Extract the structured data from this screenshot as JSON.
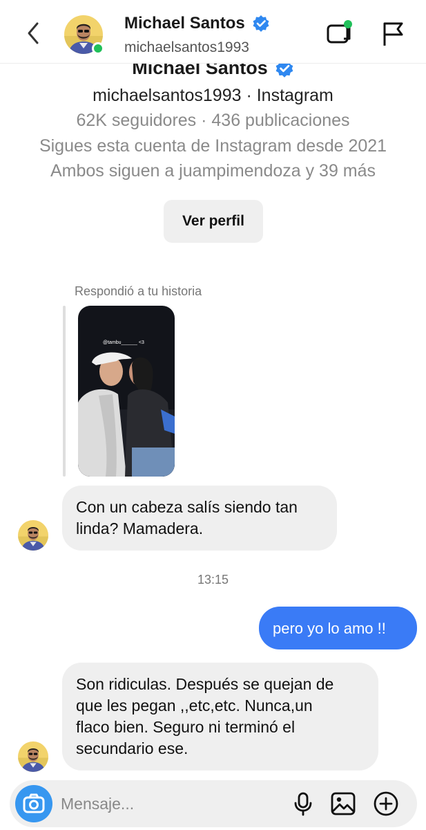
{
  "header": {
    "name": "Michael Santos",
    "username": "michaelsantos1993",
    "icons": [
      "back-chevron-icon",
      "verified-badge-icon",
      "video-call-icon",
      "report-flag-icon"
    ]
  },
  "profile": {
    "name": "Michael Santos",
    "subtitle": "michaelsantos1993 · Instagram",
    "stats": "62K seguidores · 436 publicaciones",
    "following_since": "Sigues esta cuenta de Instagram desde 2021",
    "mutuals": "Ambos siguen a juampimendoza y 39 más",
    "view_profile_label": "Ver perfil"
  },
  "story_reply": {
    "caption": "Respondió a tu historia",
    "thumb_tag": "@tambu______ <3"
  },
  "messages": [
    {
      "direction": "incoming",
      "lines": [
        "Con un cabeza salís siendo tan",
        "linda? Mamadera."
      ]
    },
    {
      "direction": "separator",
      "text": "13:15"
    },
    {
      "direction": "outgoing",
      "text": "pero yo lo amo !!"
    },
    {
      "direction": "incoming",
      "lines": [
        "Son ridiculas. Después se quejan de",
        "que les pegan ,,etc,etc. Nunca,un",
        "flaco bien. Seguro ni terminó el",
        "secundario ese."
      ]
    }
  ],
  "composer": {
    "placeholder": "Mensaje...",
    "icons": [
      "camera-icon",
      "microphone-icon",
      "gallery-icon",
      "plus-circle-icon"
    ]
  },
  "colors": {
    "accent_blue": "#3797f0",
    "outgoing_bubble": "#3a7bf6",
    "incoming_bubble": "#efefef",
    "online_green": "#21c05a",
    "verified_blue": "#2f88f0"
  }
}
